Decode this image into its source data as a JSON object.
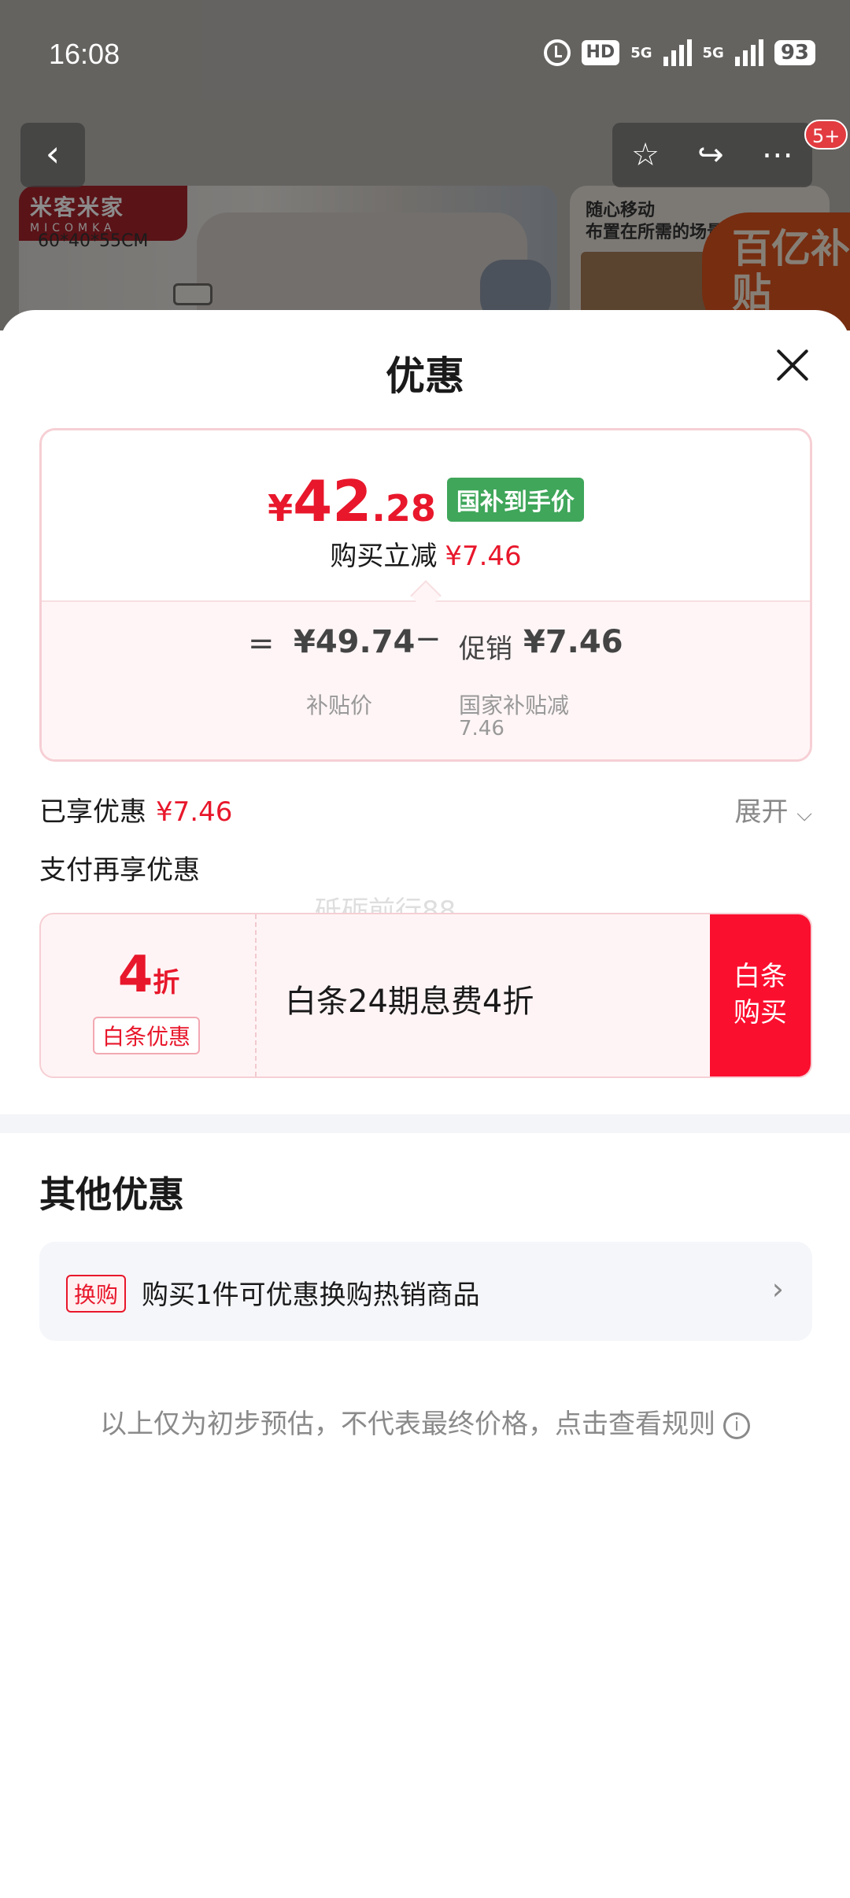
{
  "status_bar": {
    "time": "16:08",
    "hd_label": "HD",
    "net1": "5G",
    "net2": "5G",
    "battery": "93"
  },
  "background_page": {
    "brand_cn": "米客米家",
    "brand_en": "MICOMKA",
    "size_text": "60*40*55CM",
    "promo_line1": "随心移动",
    "promo_line2": "布置在所需的场景",
    "badge_text": "百亿补贴",
    "cart_count": "5+"
  },
  "sheet": {
    "title": "优惠",
    "price": {
      "currency": "¥",
      "integer": "42",
      "decimal": ".28",
      "tag": "国补到手价",
      "reduce_label": "购买立减",
      "reduce_value": "¥7.46"
    },
    "breakdown": {
      "equals": "=",
      "value1": "¥49.74",
      "label1": "补贴价",
      "minus": "−",
      "label2": "促销",
      "value2": "¥7.46",
      "sub2": "国家补贴减",
      "sub2_value": "7.46"
    },
    "enjoyed_label": "已享优惠",
    "enjoyed_value": "¥7.46",
    "expand_label": "展开",
    "pay_title": "支付再享优惠",
    "watermark": "砥砺前行88",
    "coupon": {
      "number": "4",
      "unit": "折",
      "tag": "白条优惠",
      "text": "白条24期息费4折",
      "button_line1": "白条",
      "button_line2": "购买"
    },
    "other_title": "其他优惠",
    "other_row": {
      "tag": "换购",
      "text": "购买1件可优惠换购热销商品"
    },
    "rules_text": "以上仅为初步预估，不代表最终价格，点击查看规则"
  },
  "colors": {
    "accent_red": "#e8172b",
    "button_red": "#fb0f2f",
    "tag_green": "#3fa65a"
  }
}
